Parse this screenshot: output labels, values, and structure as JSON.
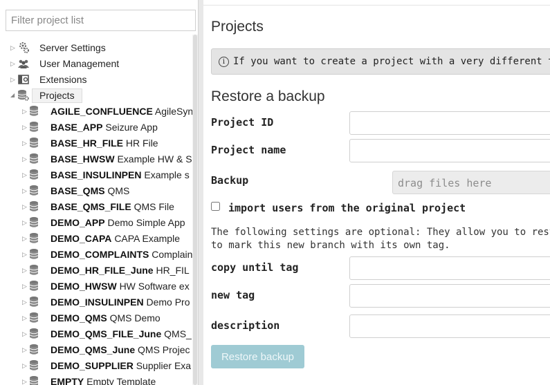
{
  "filter": {
    "placeholder": "Filter project list"
  },
  "tree": {
    "top_items": [
      {
        "label": "Server Settings",
        "icon": "gears-icon"
      },
      {
        "label": "User Management",
        "icon": "users-icon"
      },
      {
        "label": "Extensions",
        "icon": "extensions-icon"
      },
      {
        "label": "Projects",
        "icon": "database-gear-icon",
        "selected": true
      }
    ],
    "projects": [
      {
        "id": "AGILE_CONFLUENCE",
        "name": "AgileSyn"
      },
      {
        "id": "BASE_APP",
        "name": "Seizure App"
      },
      {
        "id": "BASE_HR_FILE",
        "name": "HR File"
      },
      {
        "id": "BASE_HWSW",
        "name": "Example HW & S"
      },
      {
        "id": "BASE_INSULINPEN",
        "name": "Example s"
      },
      {
        "id": "BASE_QMS",
        "name": "QMS"
      },
      {
        "id": "BASE_QMS_FILE",
        "name": "QMS File"
      },
      {
        "id": "DEMO_APP",
        "name": "Demo Simple App"
      },
      {
        "id": "DEMO_CAPA",
        "name": "CAPA Example"
      },
      {
        "id": "DEMO_COMPLAINTS",
        "name": "Complain"
      },
      {
        "id": "DEMO_HR_FILE_June",
        "name": "HR_FIL"
      },
      {
        "id": "DEMO_HWSW",
        "name": "HW Software ex"
      },
      {
        "id": "DEMO_INSULINPEN",
        "name": "Demo Pro"
      },
      {
        "id": "DEMO_QMS",
        "name": "QMS Demo"
      },
      {
        "id": "DEMO_QMS_FILE_June",
        "name": "QMS_"
      },
      {
        "id": "DEMO_QMS_June",
        "name": "QMS Projec"
      },
      {
        "id": "DEMO_SUPPLIER",
        "name": "Supplier Exa"
      },
      {
        "id": "EMPTY",
        "name": "Empty Template"
      }
    ]
  },
  "main": {
    "title": "Projects",
    "info": "If you want to create a project with a very different traceability se",
    "restore": {
      "title": "Restore a backup",
      "project_id_label": "Project ID",
      "project_name_label": "Project name",
      "backup_label": "Backup",
      "drop_text": "drag files here",
      "import_users_label": "import users from the original project",
      "optional_line1": "The following settings are optional: They allow you to restore the proj",
      "optional_line2": "to mark this new branch with its own tag.",
      "copy_until_tag_label": "copy until tag",
      "new_tag_label": "new tag",
      "description_label": "description",
      "button_label": "Restore backup"
    }
  },
  "colors": {
    "button_bg": "#9fcbd4",
    "info_bg": "#e4e4e4"
  }
}
